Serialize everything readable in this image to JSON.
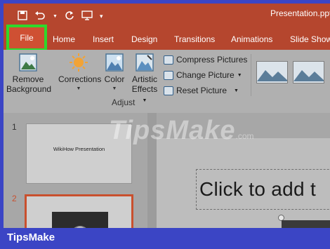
{
  "window": {
    "title": "Presentation.ppt"
  },
  "tabs": [
    {
      "label": "File"
    },
    {
      "label": "Home"
    },
    {
      "label": "Insert"
    },
    {
      "label": "Design"
    },
    {
      "label": "Transitions"
    },
    {
      "label": "Animations"
    },
    {
      "label": "Slide Show"
    }
  ],
  "ribbon": {
    "remove_background": {
      "line1": "Remove",
      "line2": "Background"
    },
    "corrections": {
      "label": "Corrections"
    },
    "color": {
      "label": "Color"
    },
    "artistic_effects": {
      "line1": "Artistic",
      "line2": "Effects"
    },
    "compress_pictures": "Compress Pictures",
    "change_picture": "Change Picture",
    "reset_picture": "Reset Picture",
    "group_label": "Adjust"
  },
  "slides": [
    {
      "number": "1",
      "text": "WikiHow Presentation"
    },
    {
      "number": "2"
    }
  ],
  "editor": {
    "placeholder_text": "Click to add t"
  },
  "watermark": {
    "text": "TipsMake",
    "domain": ".com"
  },
  "brand": {
    "name": "TipsMake"
  },
  "colors": {
    "title_bar": "#b5462e",
    "file_tab": "#cf5033",
    "highlight": "#2ed82b",
    "frame": "#3b45c5"
  }
}
